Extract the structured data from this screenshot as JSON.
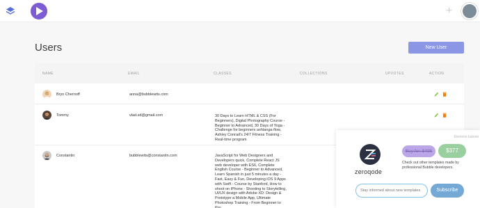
{
  "header": {
    "icons": [
      "layers-icon",
      "play-logo-icon",
      "plus-icon",
      "user-avatar"
    ],
    "brand_color": "#7c5bd3"
  },
  "page": {
    "title": "Users",
    "new_user_label": "New User"
  },
  "table": {
    "columns": [
      "NAME",
      "EMAIL",
      "CLASSES",
      "COLLECTIONS",
      "UPVOTES",
      "ACTION"
    ],
    "rows": [
      {
        "name": "Bryn Chernoff",
        "email": "anna@bubblewits.com",
        "classes": "",
        "collections": "",
        "upvotes": ""
      },
      {
        "name": "Tommy",
        "email": "vlad.sd@gmail.com",
        "classes": "30 Days to Learn HTML & CSS (For Beginners), Digital Photography Course - Beginner to Advanced, 30 Days of Yoga - Challenge for beginners ashtanga flow, Ashley Conrad's 24/7 Fitness Training - Real-time program",
        "collections": "",
        "upvotes": ""
      },
      {
        "name": "Constantin",
        "email": "bubblewits@constantin.com",
        "classes": "JavaScript for Web Designers and Developers quick, Complete React JS web developer with ES6, Complete English Course - Beginner to Advanced, Learn Spanish in just 5 minutes a day - Fast, Easy & Fun, Developing iOS 9 Apps with Swift - Course by Stanford, How to shoot on iPhone - Shooting to Storytelling, UI/UX design with Adobe XD: Design & Prototype a Mobile App, Ultimate Photoshop Training - From Beginner to Pro",
        "collections": "",
        "upvotes": ""
      }
    ],
    "edit_color": "#8bc34a",
    "delete_color": "#f57c00"
  },
  "promo": {
    "remove_label": "Remove banner",
    "brand_name": "zeroqode",
    "old_price_label": "Buy for: $495",
    "price_label": "$377",
    "description": "Check out other templates made by professional Bubble developers.",
    "email_placeholder": "Stay informed about new templates",
    "subscribe_label": "Subscribe"
  }
}
